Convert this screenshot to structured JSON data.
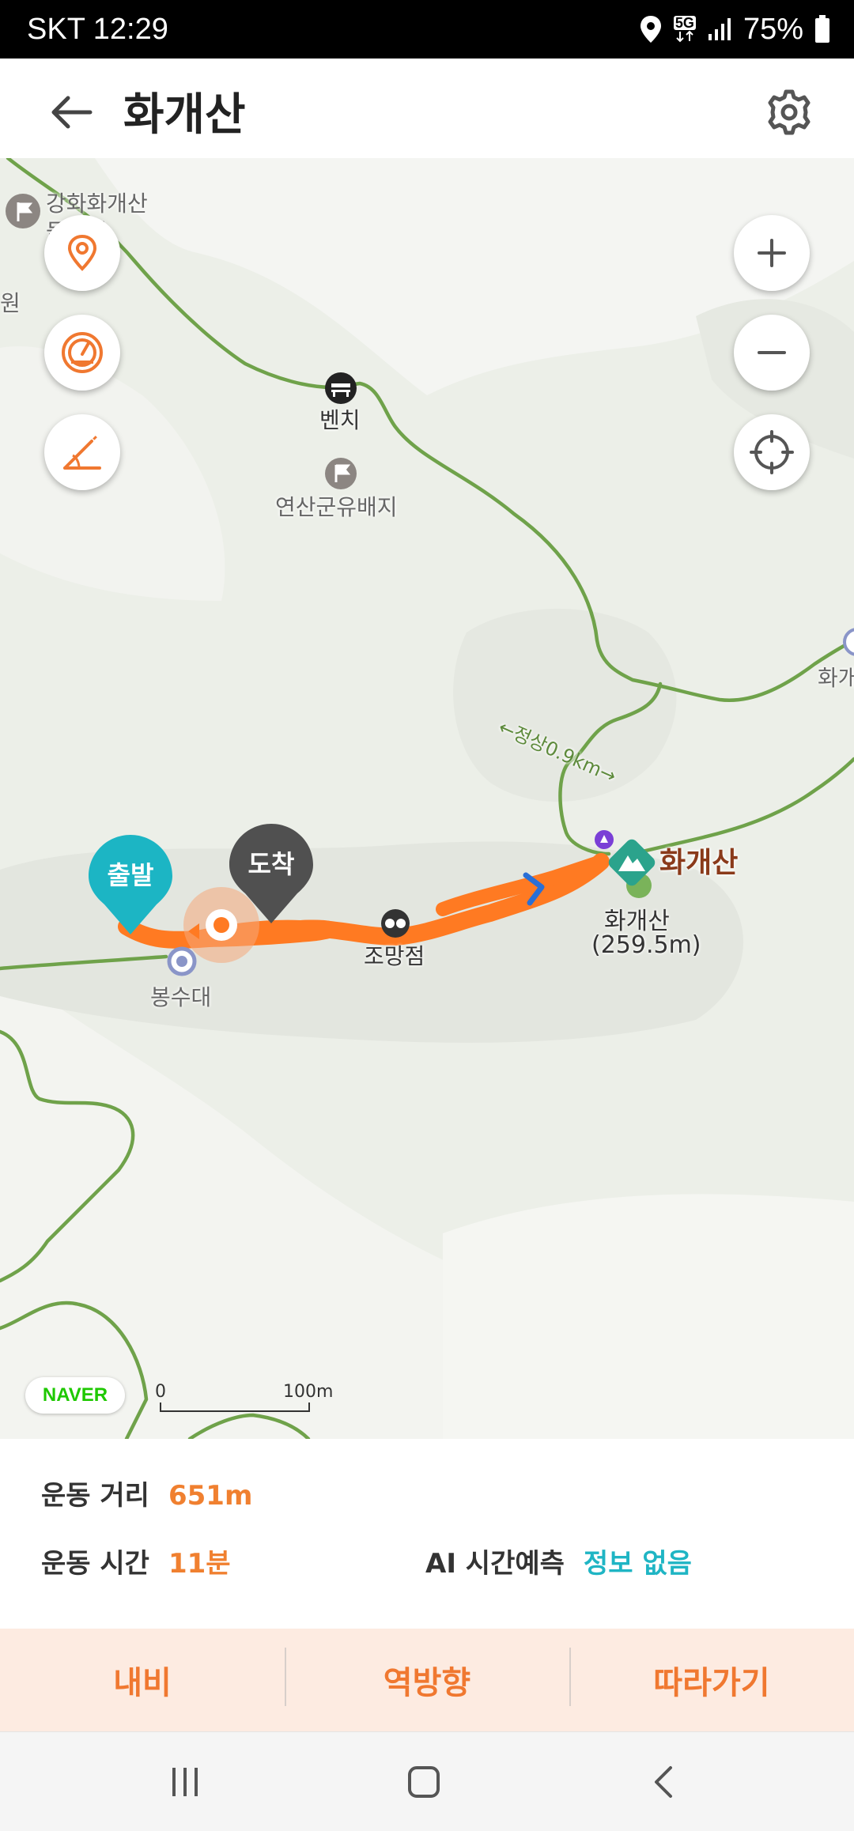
{
  "status_bar": {
    "carrier_time": "SKT 12:29",
    "network": "5G",
    "battery": "75%"
  },
  "header": {
    "title": "화개산",
    "back_icon": "arrow-left-icon",
    "settings_icon": "gear-icon"
  },
  "map": {
    "labels": {
      "trail_top": "강화화개산",
      "trail_top2": "둘레길",
      "edge_left": "원",
      "bench": "벤치",
      "camp": "연산군유배지",
      "trail_distance": "←정상0.9km→",
      "right_edge": "화개",
      "summit_big": "화개산",
      "summit_name": "화개산",
      "summit_elev": "(259.5m)",
      "viewpoint": "조망점",
      "beacon": "봉수대"
    },
    "pins": {
      "start": "출발",
      "end": "도착"
    },
    "controls": [
      "location-pin-icon",
      "speedometer-icon",
      "slope-icon",
      "zoom-in-icon",
      "zoom-out-icon",
      "crosshair-icon"
    ],
    "logo": "NAVER",
    "scale": {
      "zero": "0",
      "max": "100m"
    },
    "colors": {
      "trail": "#6fa24a",
      "route": "#ff7a22",
      "start_pin": "#1cb5c4",
      "end_pin": "#505050"
    }
  },
  "info": {
    "distance_label": "운동 거리",
    "distance_value": "651m",
    "time_label": "운동 시간",
    "time_value": "11분",
    "ai_label": "AI 시간예측",
    "ai_value": "정보 없음"
  },
  "actions": {
    "navi": "내비",
    "reverse": "역방향",
    "follow": "따라가기"
  }
}
